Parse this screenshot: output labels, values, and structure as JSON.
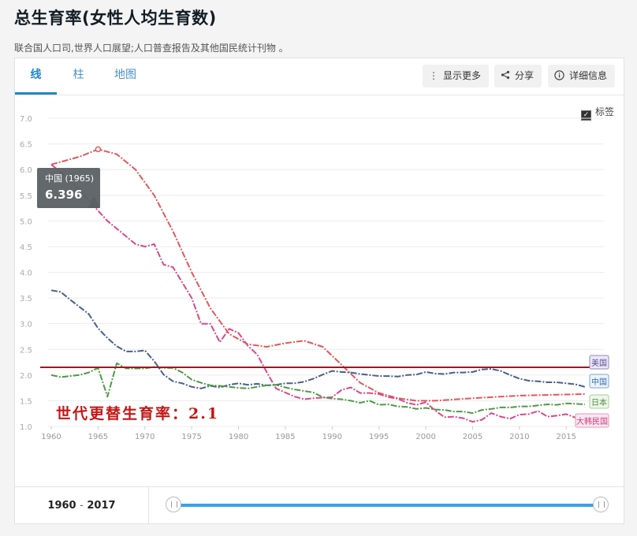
{
  "page": {
    "title": "总生育率(女性人均生育数)",
    "source": "联合国人口司,世界人口展望;人口普查报告及其他国民统计刊物 。"
  },
  "tabs": [
    {
      "label": "线",
      "active": true
    },
    {
      "label": "柱",
      "active": false
    },
    {
      "label": "地图",
      "active": false
    }
  ],
  "toolbar": {
    "more_label": "显示更多",
    "share_label": "分享",
    "details_label": "详细信息",
    "more_icon": "vertical-dots-icon",
    "share_icon": "share-icon",
    "details_icon": "info-icon"
  },
  "labels_toggle": {
    "label": "标签",
    "checked": true
  },
  "tooltip": {
    "title": "中国 (1965)",
    "value": "6.396"
  },
  "annotation": {
    "text": "世代更替生育率：2.1"
  },
  "range": {
    "start": "1960",
    "sep": "-",
    "end": "2017"
  },
  "chart_data": {
    "type": "line",
    "x_ticks": [
      1960,
      1965,
      1970,
      1975,
      1980,
      1985,
      1990,
      1995,
      2000,
      2005,
      2010,
      2015
    ],
    "y_ticks": [
      "1.0",
      "1.5",
      "2.0",
      "2.5",
      "3.0",
      "3.5",
      "4.0",
      "4.5",
      "5.0",
      "5.5",
      "6.0",
      "6.5",
      "7.0"
    ],
    "ylim": [
      1.0,
      7.0
    ],
    "xlim": [
      1960,
      2017
    ],
    "grid": true,
    "replacement_level": 2.15,
    "replacement_color": "#9b1b1b",
    "series": [
      {
        "name": "中国",
        "color": "#e0585b",
        "label_bg": "#eef4fb",
        "label_border": "#7aa6d6",
        "label_color": "#2f6fb0",
        "x": [
          1960,
          1963,
          1965,
          1967,
          1969,
          1971,
          1973,
          1975,
          1977,
          1979,
          1981,
          1983,
          1985,
          1987,
          1989,
          1991,
          1993,
          1995,
          1997,
          1999,
          2001,
          2005,
          2010,
          2017
        ],
        "y": [
          6.1,
          6.25,
          6.396,
          6.3,
          6.0,
          5.5,
          4.8,
          4.0,
          3.3,
          2.8,
          2.6,
          2.55,
          2.62,
          2.67,
          2.55,
          2.2,
          1.85,
          1.65,
          1.55,
          1.5,
          1.5,
          1.55,
          1.6,
          1.63
        ]
      },
      {
        "name": "大韩民国",
        "color": "#d64a8c",
        "label_bg": "#fbe7f0",
        "label_border": "#e39ab9",
        "label_color": "#c9407e",
        "x": [
          1960,
          1962,
          1964,
          1966,
          1968,
          1969,
          1970,
          1971,
          1972,
          1973,
          1974,
          1975,
          1976,
          1977,
          1978,
          1979,
          1980,
          1981,
          1982,
          1983,
          1984,
          1985,
          1986,
          1987,
          1988,
          1989,
          1990,
          1991,
          1992,
          1993,
          1994,
          1995,
          1996,
          1997,
          1998,
          1999,
          2000,
          2001,
          2002,
          2003,
          2004,
          2005,
          2006,
          2007,
          2008,
          2009,
          2010,
          2011,
          2012,
          2013,
          2014,
          2015,
          2016,
          2017
        ],
        "y": [
          6.1,
          5.8,
          5.4,
          5.0,
          4.7,
          4.55,
          4.5,
          4.55,
          4.15,
          4.1,
          3.8,
          3.5,
          3.0,
          3.0,
          2.64,
          2.9,
          2.82,
          2.57,
          2.4,
          2.06,
          1.74,
          1.66,
          1.58,
          1.53,
          1.55,
          1.56,
          1.57,
          1.71,
          1.76,
          1.65,
          1.65,
          1.63,
          1.57,
          1.54,
          1.46,
          1.42,
          1.47,
          1.31,
          1.18,
          1.19,
          1.16,
          1.09,
          1.13,
          1.26,
          1.19,
          1.15,
          1.23,
          1.24,
          1.3,
          1.19,
          1.21,
          1.24,
          1.17,
          1.05
        ]
      },
      {
        "name": "美国",
        "color": "#4a5f8a",
        "label_bg": "#ece9f5",
        "label_border": "#8f86be",
        "label_color": "#5b4a99",
        "x": [
          1960,
          1961,
          1962,
          1963,
          1964,
          1965,
          1966,
          1967,
          1968,
          1969,
          1970,
          1971,
          1972,
          1973,
          1974,
          1975,
          1976,
          1977,
          1978,
          1979,
          1980,
          1981,
          1982,
          1983,
          1984,
          1985,
          1986,
          1987,
          1988,
          1989,
          1990,
          1991,
          1992,
          1993,
          1994,
          1995,
          1996,
          1997,
          1998,
          1999,
          2000,
          2001,
          2002,
          2003,
          2004,
          2005,
          2006,
          2007,
          2008,
          2009,
          2010,
          2011,
          2012,
          2013,
          2014,
          2015,
          2016,
          2017
        ],
        "y": [
          3.65,
          3.62,
          3.47,
          3.33,
          3.19,
          2.91,
          2.72,
          2.56,
          2.46,
          2.46,
          2.48,
          2.27,
          2.01,
          1.88,
          1.84,
          1.77,
          1.74,
          1.79,
          1.76,
          1.81,
          1.84,
          1.81,
          1.83,
          1.8,
          1.81,
          1.84,
          1.84,
          1.87,
          1.93,
          2.01,
          2.08,
          2.06,
          2.05,
          2.02,
          2.0,
          1.98,
          1.98,
          1.97,
          2.0,
          2.01,
          2.06,
          2.03,
          2.02,
          2.05,
          2.05,
          2.06,
          2.11,
          2.12,
          2.08,
          2.0,
          1.93,
          1.89,
          1.88,
          1.86,
          1.86,
          1.84,
          1.82,
          1.77
        ]
      },
      {
        "name": "日本",
        "color": "#4f9a45",
        "label_bg": "#eef6ea",
        "label_border": "#a8cf9c",
        "label_color": "#4f8b44",
        "x": [
          1960,
          1961,
          1962,
          1963,
          1964,
          1965,
          1966,
          1967,
          1968,
          1969,
          1970,
          1971,
          1972,
          1973,
          1974,
          1975,
          1976,
          1977,
          1978,
          1979,
          1980,
          1981,
          1982,
          1983,
          1984,
          1985,
          1986,
          1987,
          1988,
          1989,
          1990,
          1991,
          1992,
          1993,
          1994,
          1995,
          1996,
          1997,
          1998,
          1999,
          2000,
          2001,
          2002,
          2003,
          2004,
          2005,
          2006,
          2007,
          2008,
          2009,
          2010,
          2011,
          2012,
          2013,
          2014,
          2015,
          2016,
          2017
        ],
        "y": [
          2.0,
          1.96,
          1.98,
          2.0,
          2.05,
          2.14,
          1.58,
          2.23,
          2.13,
          2.13,
          2.13,
          2.16,
          2.14,
          2.14,
          2.05,
          1.91,
          1.85,
          1.8,
          1.79,
          1.77,
          1.75,
          1.74,
          1.77,
          1.8,
          1.81,
          1.76,
          1.72,
          1.69,
          1.66,
          1.57,
          1.54,
          1.53,
          1.5,
          1.46,
          1.5,
          1.42,
          1.43,
          1.39,
          1.38,
          1.34,
          1.36,
          1.33,
          1.32,
          1.29,
          1.29,
          1.26,
          1.32,
          1.34,
          1.37,
          1.37,
          1.39,
          1.39,
          1.41,
          1.43,
          1.42,
          1.45,
          1.44,
          1.43
        ]
      }
    ]
  }
}
